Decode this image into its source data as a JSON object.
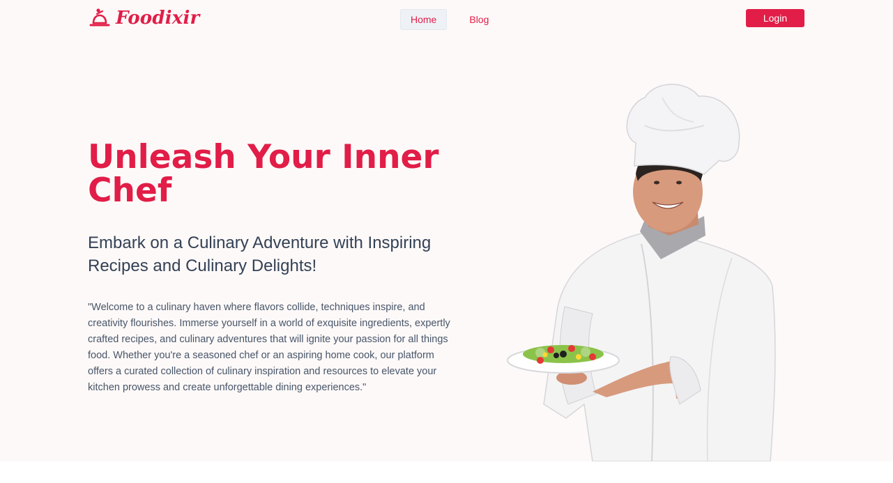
{
  "brand": {
    "name": "Foodixir",
    "color": "#e11d48"
  },
  "nav": {
    "items": [
      {
        "label": "Home",
        "active": true
      },
      {
        "label": "Blog",
        "active": false
      }
    ]
  },
  "header": {
    "login_label": "Login"
  },
  "hero": {
    "title": "Unleash Your Inner Chef",
    "subtitle": "Embark on a Culinary Adventure with Inspiring Recipes and Culinary Delights!",
    "body": "\"Welcome to a culinary haven where flavors collide, techniques inspire, and creativity flourishes. Immerse yourself in a world of exquisite ingredients, expertly crafted recipes, and culinary adventures that will ignite your passion for all things food. Whether you're a seasoned chef or an aspiring home cook, our platform offers a curated collection of culinary inspiration and resources to elevate your kitchen prowess and create unforgettable dining experiences.\""
  },
  "icons": {
    "logo": "cloche-chef-icon"
  }
}
